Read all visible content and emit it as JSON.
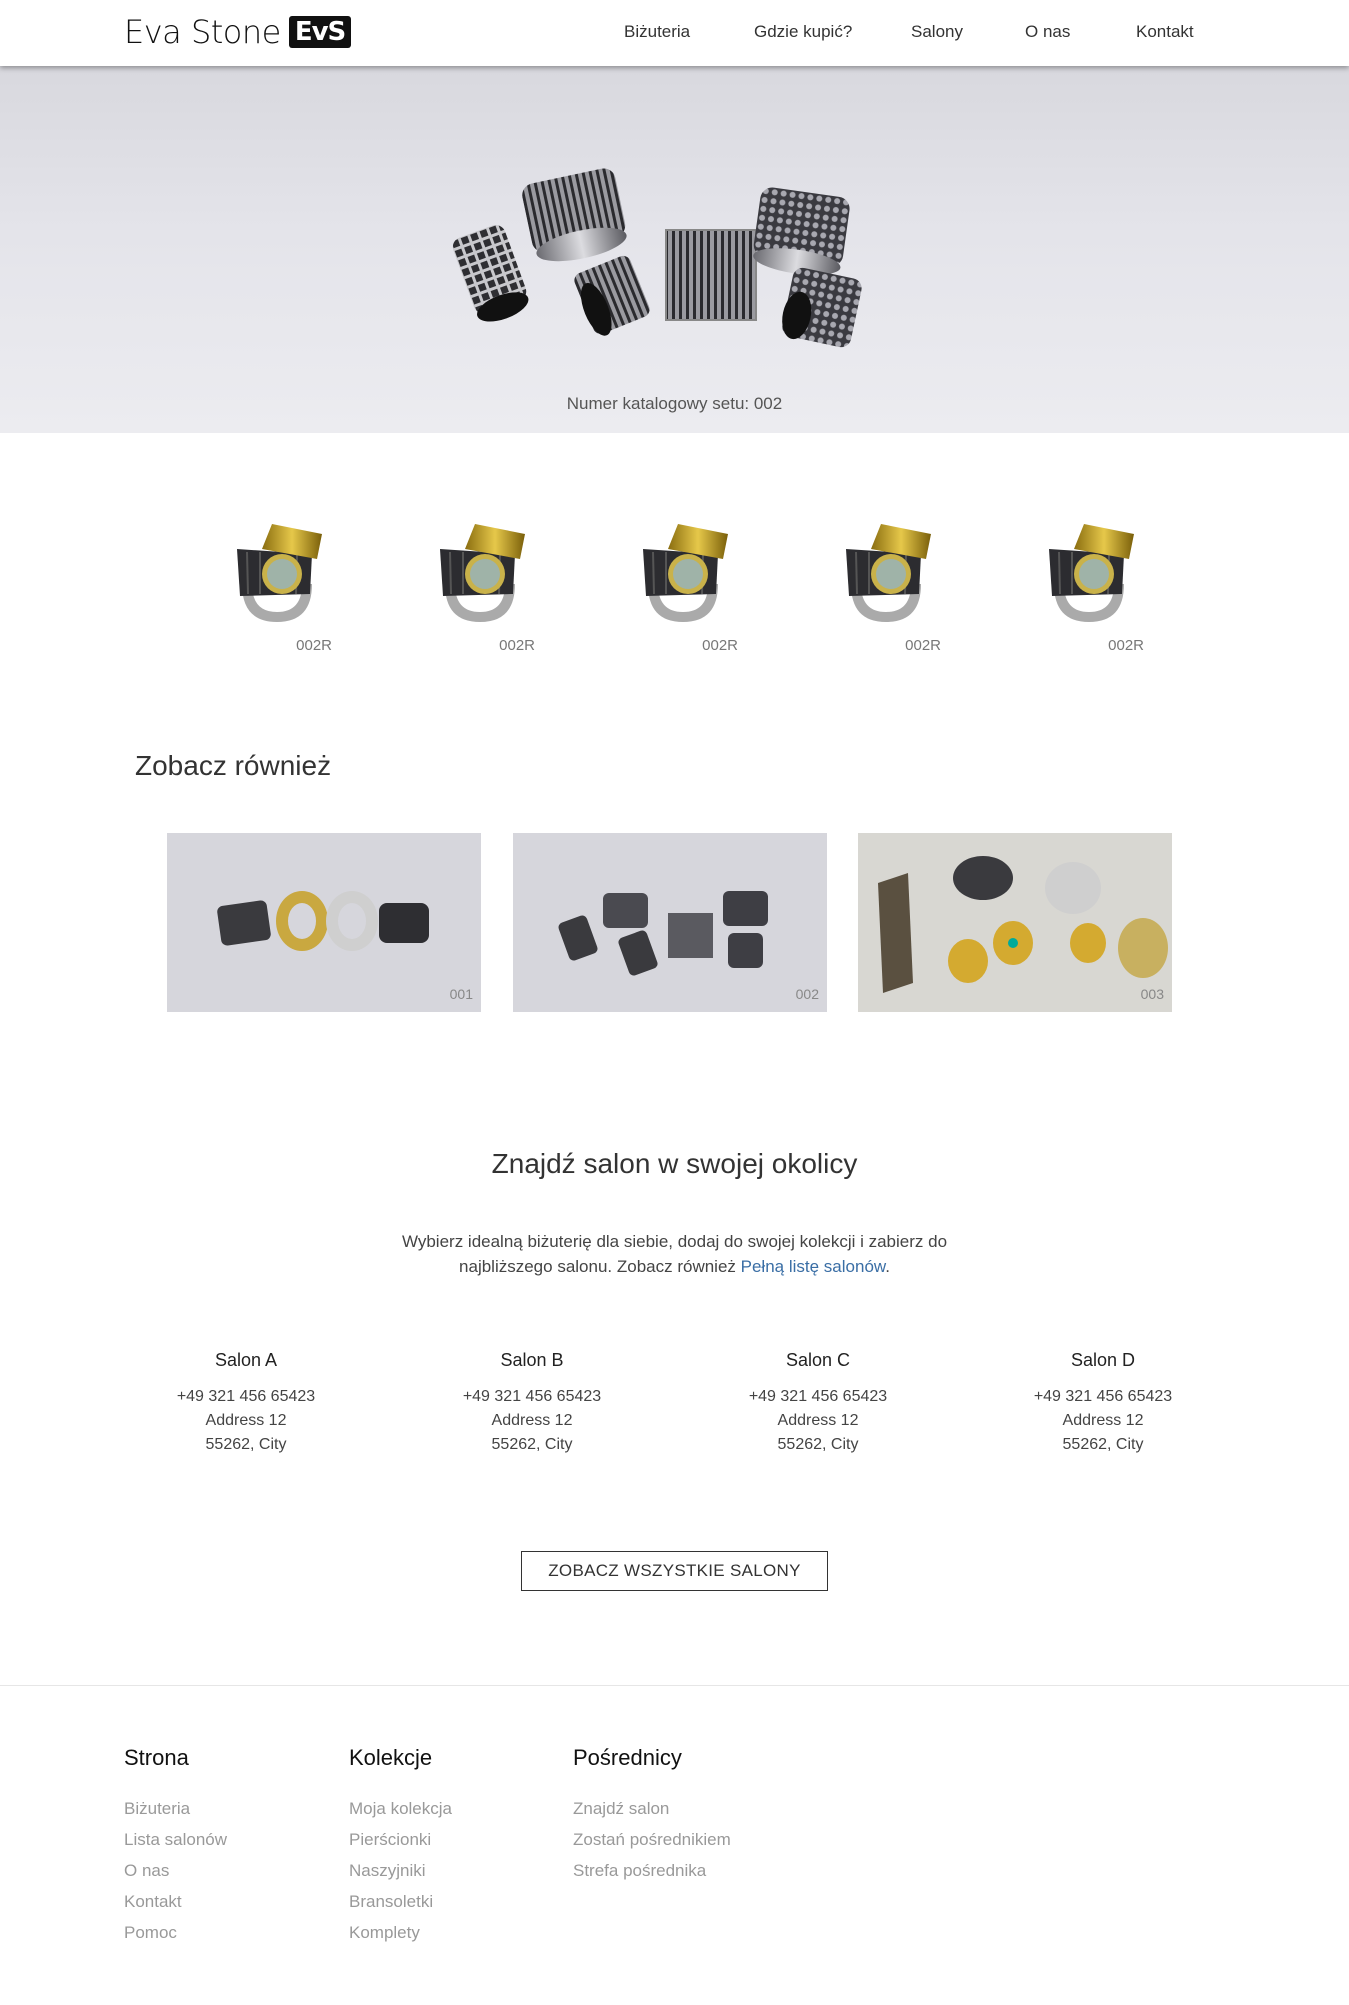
{
  "header": {
    "logo_text": "Eva Stone",
    "logo_mark": "EvS",
    "nav": [
      "Biżuteria",
      "Gdzie kupić?",
      "Salony",
      "O nas",
      "Kontakt"
    ]
  },
  "hero": {
    "caption": "Numer katalogowy setu: 002"
  },
  "products": [
    {
      "code": "002R"
    },
    {
      "code": "002R"
    },
    {
      "code": "002R"
    },
    {
      "code": "002R"
    },
    {
      "code": "002R"
    }
  ],
  "see_also": {
    "title": "Zobacz również",
    "cards": [
      {
        "label": "001"
      },
      {
        "label": "002"
      },
      {
        "label": "003"
      }
    ]
  },
  "salons_section": {
    "title": "Znajdź salon w swojej okolicy",
    "desc_before": "Wybierz idealną biżuterię dla siebie, dodaj do swojej kolekcji i zabierz do najbliższego salonu. Zobacz również ",
    "desc_link": "Pełną listę salonów",
    "desc_after": ".",
    "salons": [
      {
        "name": "Salon A",
        "phone": "+49 321 456 65423",
        "address": "Address 12",
        "city": "55262, City"
      },
      {
        "name": "Salon B",
        "phone": "+49 321 456 65423",
        "address": "Address 12",
        "city": "55262, City"
      },
      {
        "name": "Salon C",
        "phone": "+49 321 456 65423",
        "address": "Address 12",
        "city": "55262, City"
      },
      {
        "name": "Salon D",
        "phone": "+49 321 456 65423",
        "address": "Address 12",
        "city": "55262, City"
      }
    ],
    "button_label": "ZOBACZ WSZYSTKIE SALONY"
  },
  "footer": {
    "columns": [
      {
        "title": "Strona",
        "links": [
          "Biżuteria",
          "Lista salonów",
          "O nas",
          "Kontakt",
          "Pomoc"
        ]
      },
      {
        "title": "Kolekcje",
        "links": [
          "Moja kolekcja",
          "Pierścionki",
          "Naszyjniki",
          "Bransoletki",
          "Komplety"
        ]
      },
      {
        "title": "Pośrednicy",
        "links": [
          "Znajdź salon",
          "Zostań pośrednikiem",
          "Strefa pośrednika"
        ]
      }
    ]
  },
  "colors": {
    "link": "#3a6ea5",
    "footer_link": "#999999",
    "header_bg": "#ffffff"
  }
}
